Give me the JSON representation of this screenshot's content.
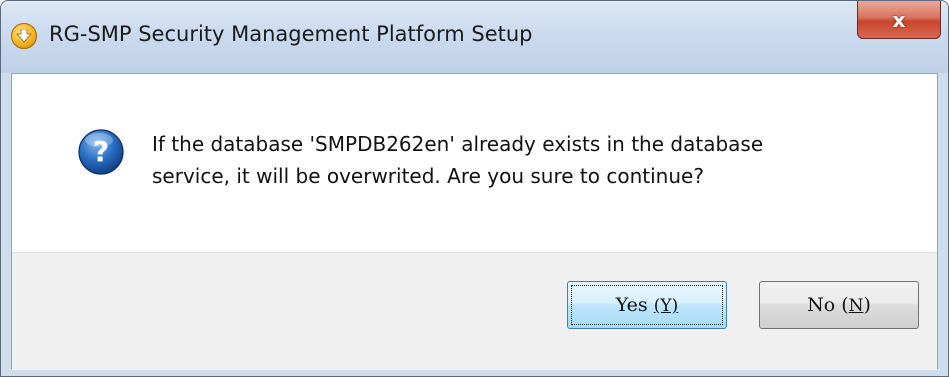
{
  "window": {
    "title": "RG-SMP Security Management Platform Setup",
    "close_label": "x",
    "title_icon": "setup-installer-icon"
  },
  "dialog": {
    "icon": "question-icon",
    "message_line1": "If the database 'SMPDB262en' already exists in the database",
    "message_line2": "service, it will be overwrited. Are you sure to continue?"
  },
  "buttons": {
    "yes_label": "Yes",
    "yes_hotkey": "(Y)",
    "no_label": "No",
    "no_hotkey_open": "(",
    "no_hotkey_key": "N",
    "no_hotkey_close": ")"
  },
  "colors": {
    "title_bar": "#cbdaee",
    "close_button": "#c8452c",
    "question_icon": "#1f62b5",
    "button_area": "#f0f0f0"
  }
}
